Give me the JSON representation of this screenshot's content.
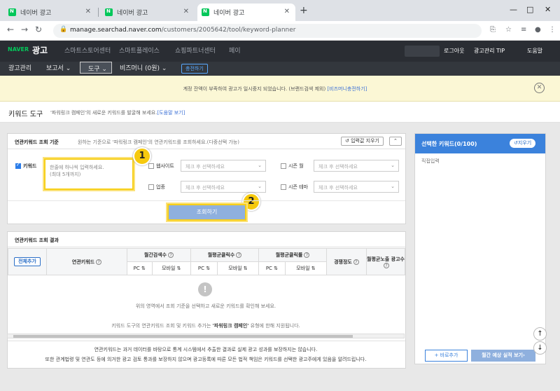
{
  "browser": {
    "tabs": [
      {
        "title": "네이버 광고",
        "active": false
      },
      {
        "title": "네이버 광고",
        "active": false
      },
      {
        "title": "네이버 광고",
        "active": true
      }
    ],
    "new_tab": "+",
    "window_controls": [
      "—",
      "□",
      "✕"
    ],
    "url_host": "manage.searchad.naver.com",
    "url_path": "/customers/2005642/tool/keyword-planner"
  },
  "gnb": {
    "logo_naver": "NAVER",
    "logo_ad": "광고",
    "menu": [
      "스마트스토어센터",
      "스마트플레이스",
      "쇼핑파트너센터",
      "페이"
    ],
    "right": [
      "로그아웃",
      "광고관리 TIP",
      "도움말"
    ]
  },
  "lnb": {
    "items": [
      "광고관리",
      "보고서 ⌄",
      "도구 ⌄",
      "비즈머니 (0원) ⌄"
    ],
    "charge_label": "충전하기"
  },
  "notice": {
    "text": "계정 잔액이 부족하여 광고가 일시중지 되었습니다. (브랜드검색 제외) ",
    "link": "[비즈머니충전하기]"
  },
  "page": {
    "title": "키워드 도구",
    "desc": "'파워링크 캠페인'의 새로운 키워드를 발굴해 보세요.",
    "help_link": "[도움말 보기]"
  },
  "criteria": {
    "title": "연관키워드 조회 기준",
    "desc": "원하는 기준으로 '파워링크 캠페인'의 연관키워드를 조회하세요.(다중선택 가능)",
    "reset_label": "입력값 지우기",
    "keyword_label": "키워드",
    "keyword_placeholder_1": "한줄에 하나씩 입력하세요.",
    "keyword_placeholder_2": "(최대 5개까지)",
    "website_label": "웹사이트",
    "industry_label": "업종",
    "season_month_label": "시즌 월",
    "season_theme_label": "시즌 테마",
    "select_placeholder": "체크 후 선택하세요",
    "search_label": "조회하기",
    "badges": [
      "1",
      "2"
    ]
  },
  "results": {
    "title": "연관키워드 조회 결과",
    "add_all": "전체추가",
    "col_keyword": "연관키워드",
    "col_monthly_search": "월간검색수",
    "col_avg_clicks": "월평균클릭수",
    "col_avg_ctr": "월평균클릭률",
    "col_competition": "경쟁정도",
    "col_avg_ads": "월평균노출 광고수",
    "sub_pc": "PC",
    "sub_mobile": "모바일",
    "empty_msg": "위의 영역에서 조회 기준을 선택하고 새로운 키워드를 확인해 보세요.",
    "support_pre": "키워드 도구의 연관키워드 조회 및 키워드 추가는 ",
    "support_bold": "'파워링크 캠페인'",
    "support_post": " 유형에 한해 지원됩니다.",
    "footnote_1": "연관키워드는 과거 데이터를 바탕으로 통계 시스템에서 추출한 결과로 실제 광고 성과를 보장하지는 않습니다.",
    "footnote_2": "또한 관계법령 및 연관도 등에 의거한 광고 검토 통과를 보장하지 않으며 광고등록에 따른 모든 법적 책임은 키워드를 선택한 광고주에게 있음을 알려드립니다."
  },
  "selected": {
    "title": "선택한 키워드(0/100)",
    "clear_label": "지우기",
    "direct_input": "직접입력",
    "add_label": "+ 바로추가",
    "estimate_label": "월간 예상 실적 보기›"
  },
  "fab": {
    "up": "↑",
    "down": "↓"
  }
}
